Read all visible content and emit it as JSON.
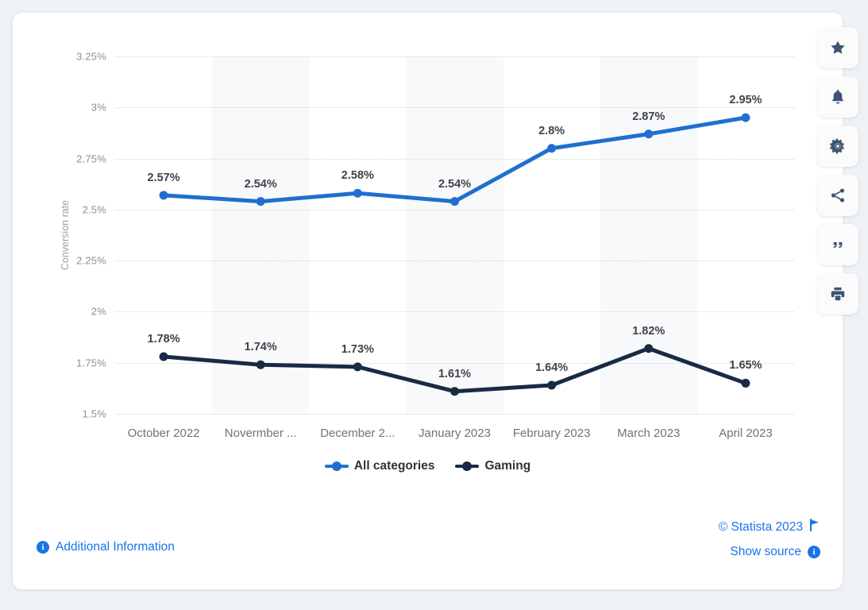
{
  "chart_data": {
    "type": "line",
    "title": "",
    "xlabel": "",
    "ylabel": "Conversion rate",
    "ylim": [
      1.5,
      3.25
    ],
    "yunit": "%",
    "grid": true,
    "legend_position": "bottom",
    "categories": [
      "October 2022",
      "Novermber ...",
      "December 2...",
      "January 2023",
      "February 2023",
      "March 2023",
      "April 2023"
    ],
    "ytick_labels": [
      "3.25%",
      "3%",
      "2.75%",
      "2.5%",
      "2.25%",
      "2%",
      "1.75%",
      "1.5%"
    ],
    "ytick_values": [
      3.25,
      3,
      2.75,
      2.5,
      2.25,
      2,
      1.75,
      1.5
    ],
    "series": [
      {
        "name": "All categories",
        "color": "#1f6fd0",
        "values": [
          2.57,
          2.54,
          2.58,
          2.54,
          2.8,
          2.87,
          2.95
        ],
        "labels": [
          "2.57%",
          "2.54%",
          "2.58%",
          "2.54%",
          "2.8%",
          "2.87%",
          "2.95%"
        ]
      },
      {
        "name": "Gaming",
        "color": "#182b44",
        "values": [
          1.78,
          1.74,
          1.73,
          1.61,
          1.64,
          1.82,
          1.65
        ],
        "labels": [
          "1.78%",
          "1.74%",
          "1.73%",
          "1.61%",
          "1.64%",
          "1.82%",
          "1.65%"
        ]
      }
    ]
  },
  "footer": {
    "additional_information": "Additional Information",
    "copyright": "© Statista 2023",
    "show_source": "Show source"
  },
  "toolbar": {
    "buttons": [
      {
        "name": "favorite-star-button",
        "icon": "star-icon"
      },
      {
        "name": "notification-bell-button",
        "icon": "bell-icon"
      },
      {
        "name": "settings-gear-button",
        "icon": "gear-icon"
      },
      {
        "name": "share-button",
        "icon": "share-icon"
      },
      {
        "name": "cite-button",
        "icon": "quote-icon"
      },
      {
        "name": "print-button",
        "icon": "print-icon"
      }
    ]
  },
  "colors": {
    "page_background": "#eef1f5",
    "card_background": "#ffffff",
    "series_all_categories": "#1f6fd0",
    "series_gaming": "#182b44",
    "link": "#1a73e8",
    "band": "#f8f9fa"
  }
}
